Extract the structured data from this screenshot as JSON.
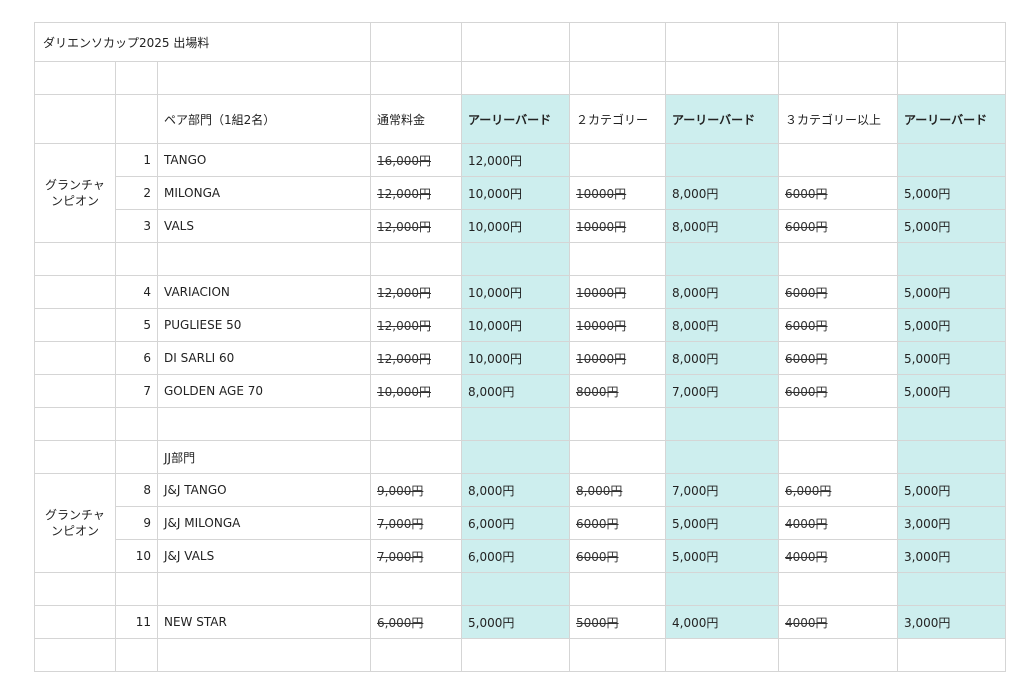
{
  "title": "ダリエンソカップ2025 出場料",
  "headers": {
    "pair": "ペア部門（1組2名）",
    "normal": "通常料金",
    "early1": "アーリーバード",
    "two_cat": "２カテゴリー",
    "early2": "アーリーバード",
    "three_cat": "３カテゴリー以上",
    "early3": "アーリーバード"
  },
  "groups": {
    "grand1": "グランチャンピオン",
    "grand2": "グランチャンピオン",
    "jj_label": "JJ部門"
  },
  "rows": [
    {
      "no": "1",
      "name": "TANGO",
      "normal": "16,000円",
      "early1": "12,000円",
      "two": "",
      "early2": "",
      "three": "",
      "early3": ""
    },
    {
      "no": "2",
      "name": "MILONGA",
      "normal": "12,000円",
      "early1": "10,000円",
      "two": "10000円",
      "early2": "8,000円",
      "three": "6000円",
      "early3": "5,000円"
    },
    {
      "no": "3",
      "name": "VALS",
      "normal": "12,000円",
      "early1": "10,000円",
      "two": "10000円",
      "early2": "8,000円",
      "three": "6000円",
      "early3": "5,000円"
    },
    {
      "no": "4",
      "name": "VARIACION",
      "normal": "12,000円",
      "early1": "10,000円",
      "two": "10000円",
      "early2": "8,000円",
      "three": "6000円",
      "early3": "5,000円"
    },
    {
      "no": "5",
      "name": "PUGLIESE 50",
      "normal": "12,000円",
      "early1": "10,000円",
      "two": "10000円",
      "early2": "8,000円",
      "three": "6000円",
      "early3": "5,000円"
    },
    {
      "no": "6",
      "name": "DI SARLI 60",
      "normal": "12,000円",
      "early1": "10,000円",
      "two": "10000円",
      "early2": "8,000円",
      "three": "6000円",
      "early3": "5,000円"
    },
    {
      "no": "7",
      "name": "GOLDEN AGE 70",
      "normal": "10,000円",
      "early1": "8,000円",
      "two": "8000円",
      "early2": "7,000円",
      "three": "6000円",
      "early3": "5,000円"
    },
    {
      "no": "8",
      "name": "J&J TANGO",
      "normal": "9,000円",
      "early1": "8,000円",
      "two": "8,000円",
      "early2": "7,000円",
      "three": "6,000円",
      "early3": "5,000円"
    },
    {
      "no": "9",
      "name": "J&J MILONGA",
      "normal": "7,000円",
      "early1": "6,000円",
      "two": "6000円",
      "early2": "5,000円",
      "three": "4000円",
      "early3": "3,000円"
    },
    {
      "no": "10",
      "name": "J&J VALS",
      "normal": "7,000円",
      "early1": "6,000円",
      "two": "6000円",
      "early2": "5,000円",
      "three": "4000円",
      "early3": "3,000円"
    },
    {
      "no": "11",
      "name": "NEW STAR",
      "normal": "6,000円",
      "early1": "5,000円",
      "two": "5000円",
      "early2": "4,000円",
      "three": "4000円",
      "early3": "3,000円"
    }
  ],
  "highlight_color": "#cdeeee"
}
